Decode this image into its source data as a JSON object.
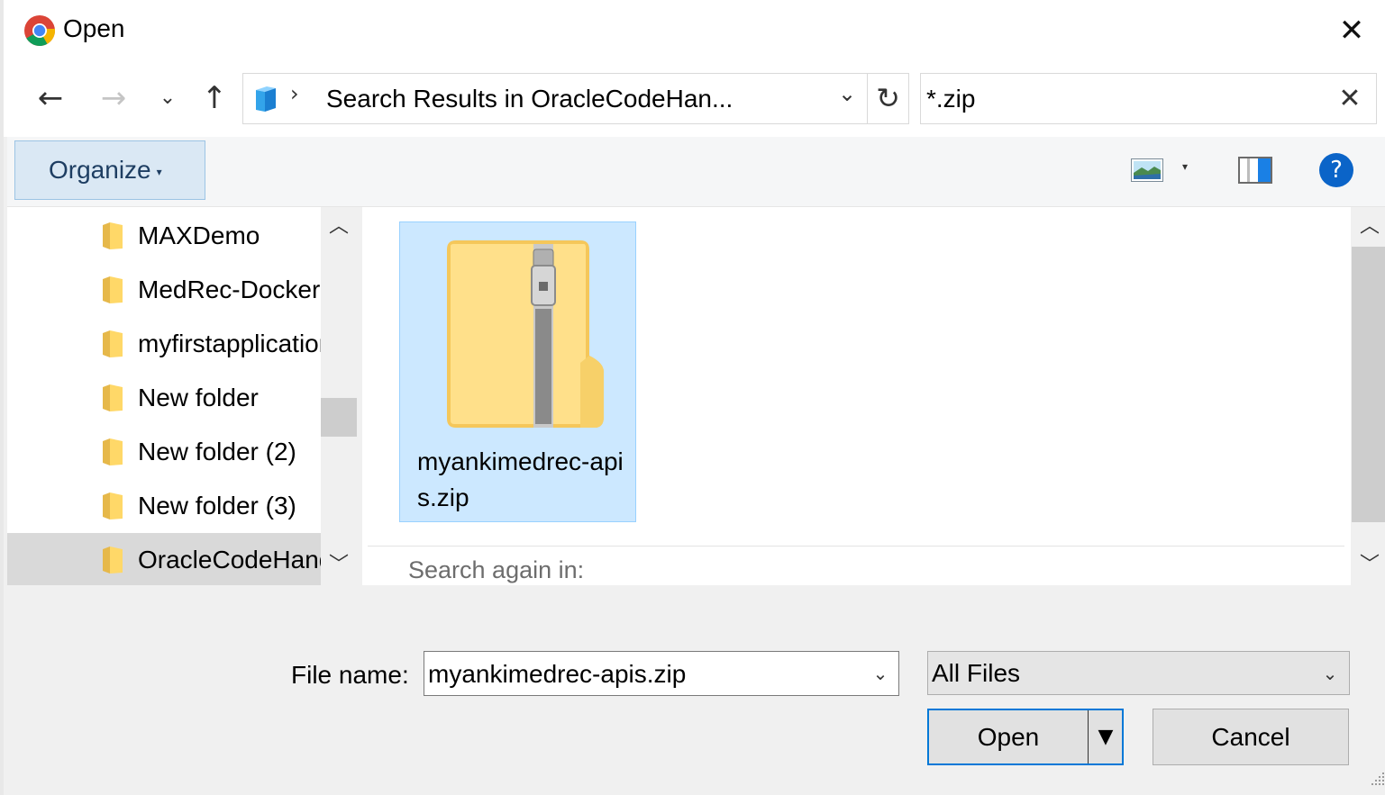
{
  "window": {
    "title": "Open",
    "close_glyph": "✕"
  },
  "nav": {
    "back_glyph": "←",
    "forward_glyph": "→",
    "recent_glyph": "⌄",
    "up_glyph": "↑",
    "address_sep_glyph": "›",
    "address_text": "Search Results in OracleCodeHan...",
    "address_drop_glyph": "⌄",
    "refresh_glyph": "↻",
    "search_value": "*.zip",
    "search_clear_glyph": "✕"
  },
  "toolbar": {
    "organize_label": "Organize",
    "organize_caret": "▾",
    "view_caret": "▾",
    "help_glyph": "?"
  },
  "tree": {
    "items": [
      {
        "label": "MAXDemo"
      },
      {
        "label": "MedRec-Docker"
      },
      {
        "label": "myfirstapplication"
      },
      {
        "label": "New folder"
      },
      {
        "label": "New folder (2)"
      },
      {
        "label": "New folder (3)"
      },
      {
        "label": "OracleCodeHandsOn"
      }
    ],
    "selected_index": 6,
    "scroll_up_glyph": "︿",
    "scroll_down_glyph": "﹀"
  },
  "content": {
    "files": [
      {
        "name": "myankimedrec-apis.zip"
      }
    ],
    "search_again_label": "Search again in:",
    "scroll_up_glyph": "︿",
    "scroll_down_glyph": "﹀"
  },
  "bottom": {
    "file_name_label": "File name:",
    "file_name_value": "myankimedrec-apis.zip",
    "file_name_drop_glyph": "⌄",
    "file_type_value": "All Files",
    "file_type_drop_glyph": "⌄",
    "open_label": "Open",
    "open_split_glyph": "▼",
    "cancel_label": "Cancel"
  },
  "colors": {
    "accent": "#0078d7",
    "selection_bg": "#cce8ff",
    "organize_bg": "#dae8f4",
    "help_blue": "#0b64c8"
  },
  "icons": {
    "app": "chrome-icon",
    "location": "search-results-icon",
    "view": "change-view-icon",
    "pane": "preview-pane-icon",
    "help": "help-icon",
    "folder": "folder-icon",
    "zip": "zip-folder-icon"
  }
}
